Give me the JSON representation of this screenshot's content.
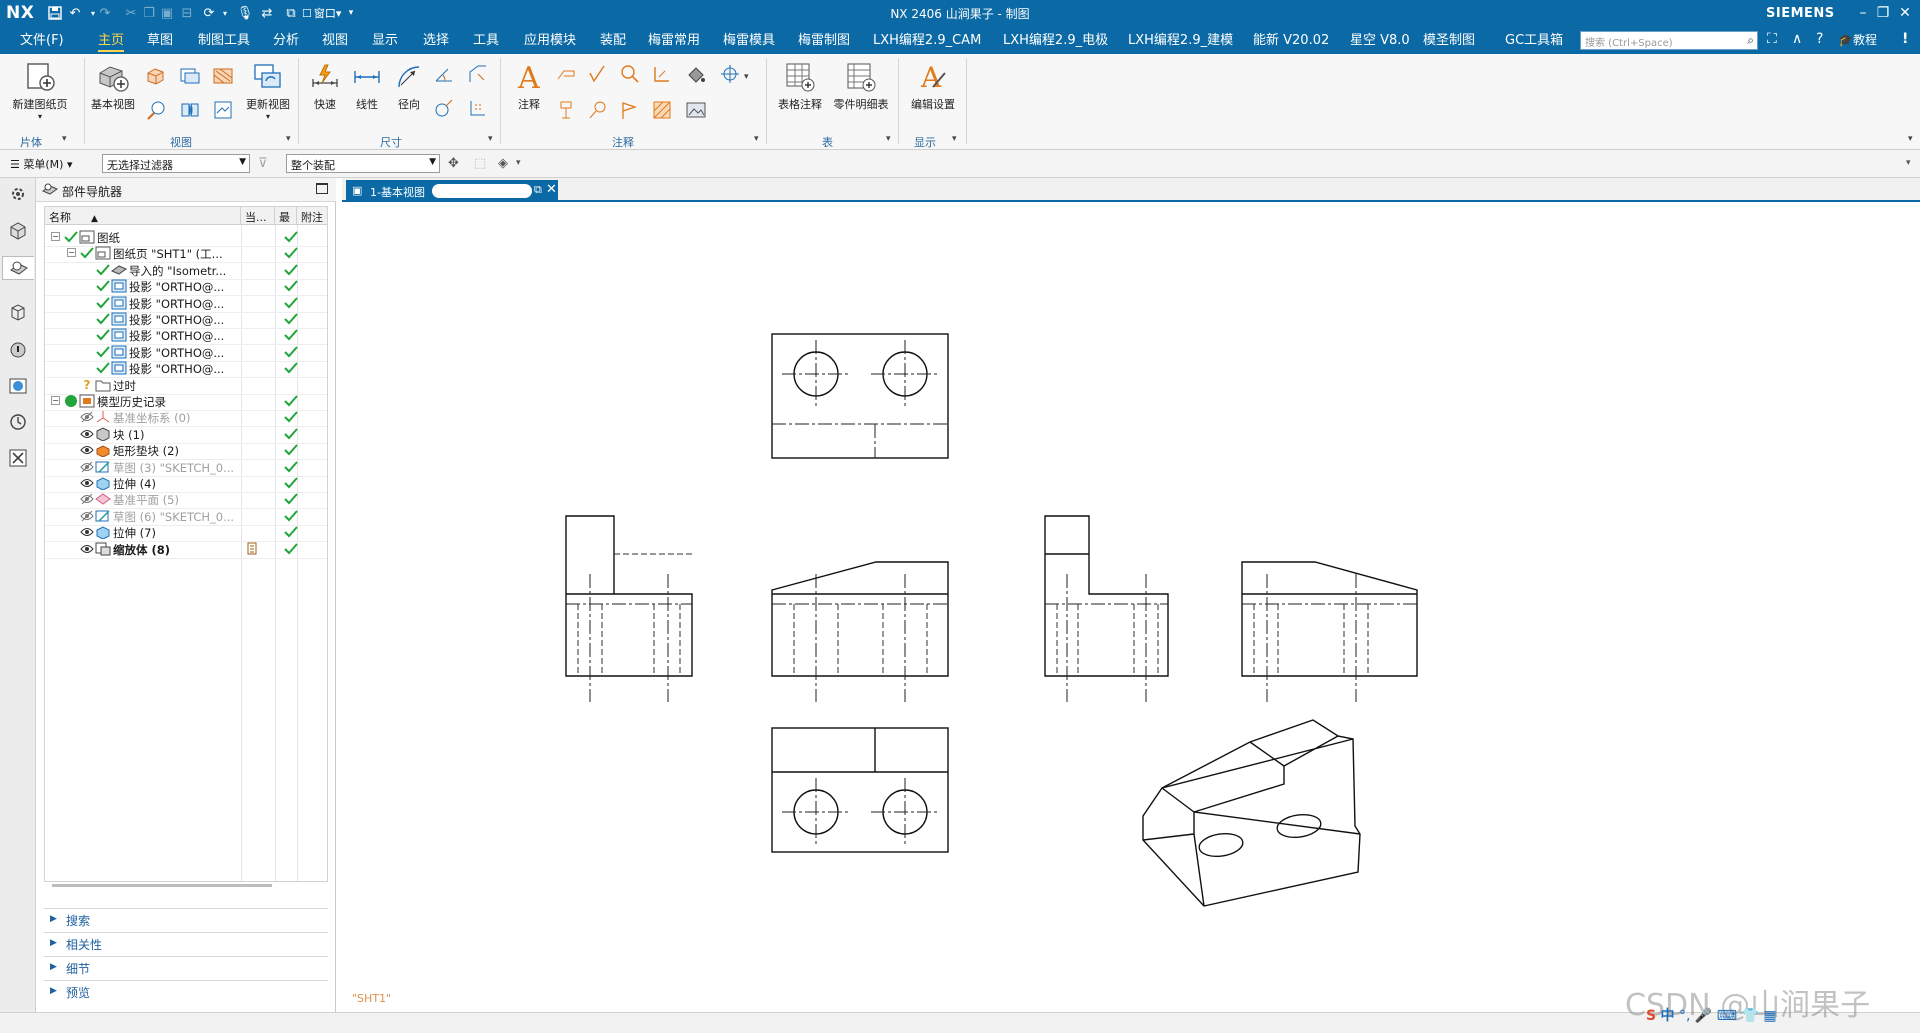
{
  "titlebar": {
    "logo": "NX",
    "window_title": "NX 2406 山涧果子 - 制图",
    "brand": "SIEMENS",
    "window_menu": "窗口"
  },
  "menubar": {
    "tabs": [
      "文件(F)",
      "主页",
      "草图",
      "制图工具",
      "分析",
      "视图",
      "显示",
      "选择",
      "工具",
      "应用模块",
      "装配",
      "梅雷常用",
      "梅雷模具",
      "梅雷制图",
      "LXH编程2.9_CAM",
      "LXH编程2.9_电极",
      "LXH编程2.9_建模",
      "能新 V20.02",
      "星空 V8.0",
      "模圣制图",
      "GC工具箱"
    ],
    "active_tab": "主页",
    "search_placeholder": "搜索 (Ctrl+Space)",
    "tutorial": "教程"
  },
  "ribbon": {
    "buttons": {
      "new_sheet": "新建图纸页",
      "base_view": "基本视图",
      "update_view": "更新视图",
      "quick": "快速",
      "linear": "线性",
      "radial": "径向",
      "note": "注释",
      "table_note": "表格注释",
      "parts_list": "零件明细表",
      "edit_settings": "编辑设置"
    },
    "groups": {
      "sheet": "片体",
      "view": "视图",
      "dimension": "尺寸",
      "annotation": "注释",
      "table": "表",
      "display": "显示"
    }
  },
  "filterbar": {
    "menu_label": "菜单(M)",
    "filter_value": "无选择过滤器",
    "scope_value": "整个装配"
  },
  "navigator": {
    "title": "部件导航器",
    "columns": {
      "name": "名称",
      "current": "当...",
      "latest": "最",
      "attach": "附注"
    },
    "rows": {
      "drawing": "图纸",
      "sheet": "图纸页 \"SHT1\" (工...",
      "imported": "导入的 \"Isometr...",
      "proj1": "投影 \"ORTHO@...",
      "proj2": "投影 \"ORTHO@...",
      "proj3": "投影 \"ORTHO@...",
      "proj4": "投影 \"ORTHO@...",
      "proj5": "投影 \"ORTHO@...",
      "proj6": "投影 \"ORTHO@...",
      "outdated": "过时",
      "history": "模型历史记录",
      "datum_csys": "基准坐标系 (0)",
      "block": "块 (1)",
      "rect_pad": "矩形垫块 (2)",
      "sketch3": "草图 (3) \"SKETCH_0...",
      "extrude4": "拉伸 (4)",
      "datum_plane": "基准平面 (5)",
      "sketch6": "草图 (6) \"SKETCH_0...",
      "extrude7": "拉伸 (7)",
      "scale_body": "缩放体 (8)"
    },
    "sections": [
      "搜索",
      "相关性",
      "细节",
      "预览"
    ]
  },
  "graphics": {
    "tab_label": "1-基本视图",
    "sheet_name": "\"SHT1\""
  },
  "watermark": "CSDN @山涧果子",
  "ime_label": "中"
}
